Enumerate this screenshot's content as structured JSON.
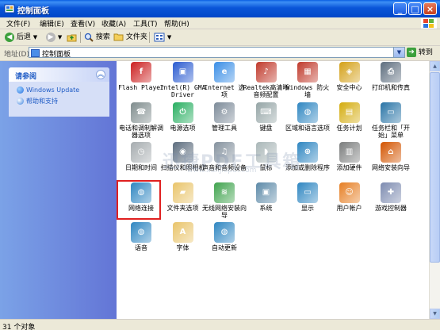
{
  "window": {
    "title": "控制面板"
  },
  "menu": [
    "文件(F)",
    "编辑(E)",
    "查看(V)",
    "收藏(A)",
    "工具(T)",
    "帮助(H)"
  ],
  "toolbar": {
    "back": "后退",
    "search": "搜索",
    "folders": "文件夹"
  },
  "address": {
    "label": "地址(D)",
    "value": "控制面板",
    "go": "转到"
  },
  "sidebar": {
    "panel_title": "请参阅",
    "links": [
      "Windows Update",
      "帮助和支持"
    ]
  },
  "items": [
    {
      "label": "Flash Player",
      "icon": "flash-icon",
      "color": "#cc1f1f"
    },
    {
      "label": "Intel(R) GMA Driver",
      "icon": "intel-display-icon",
      "color": "#2a5bd0"
    },
    {
      "label": "Internet 选项",
      "icon": "internet-options-icon",
      "color": "#3a8ee6"
    },
    {
      "label": "Realtek高清晰音频配置",
      "icon": "realtek-speaker-icon",
      "color": "#c0392b"
    },
    {
      "label": "Windows 防火墙",
      "icon": "firewall-icon",
      "color": "#c0392b"
    },
    {
      "label": "安全中心",
      "icon": "security-shield-icon",
      "color": "#d4a017"
    },
    {
      "label": "打印机和传真",
      "icon": "printer-icon",
      "color": "#5d6d7e"
    },
    {
      "label": "电话和调制解调器选项",
      "icon": "phone-modem-icon",
      "color": "#7f8c8d"
    },
    {
      "label": "电源选项",
      "icon": "power-icon",
      "color": "#27ae60"
    },
    {
      "label": "管理工具",
      "icon": "admin-tools-icon",
      "color": "#7d8b99"
    },
    {
      "label": "键盘",
      "icon": "keyboard-icon",
      "color": "#95a5a6"
    },
    {
      "label": "区域和语言选项",
      "icon": "globe-icon",
      "color": "#2e86c1"
    },
    {
      "label": "任务计划",
      "icon": "scheduled-tasks-icon",
      "color": "#d4ac0d"
    },
    {
      "label": "任务栏和「开始」菜单",
      "icon": "taskbar-icon",
      "color": "#2874a6"
    },
    {
      "label": "日期和时间",
      "icon": "clock-icon",
      "color": "#a6acaf"
    },
    {
      "label": "扫描仪和照相机",
      "icon": "scanner-camera-icon",
      "color": "#5d6d7e"
    },
    {
      "label": "声音和音频设备",
      "icon": "sound-icon",
      "color": "#85929e"
    },
    {
      "label": "鼠标",
      "icon": "mouse-icon",
      "color": "#aab7b8"
    },
    {
      "label": "添加或删除程序",
      "icon": "add-remove-programs-icon",
      "color": "#2e86c1"
    },
    {
      "label": "添加硬件",
      "icon": "add-hardware-icon",
      "color": "#7b7d7d"
    },
    {
      "label": "网络安装向导",
      "icon": "network-setup-icon",
      "color": "#d35400"
    },
    {
      "label": "网络连接",
      "icon": "network-connections-icon",
      "color": "#2e86c1"
    },
    {
      "label": "文件夹选项",
      "icon": "folder-options-icon",
      "color": "#e9c46a"
    },
    {
      "label": "无线网络安装向导",
      "icon": "wireless-icon",
      "color": "#3fa34d"
    },
    {
      "label": "系统",
      "icon": "system-icon",
      "color": "#5d8aa8"
    },
    {
      "label": "显示",
      "icon": "display-icon",
      "color": "#2e86c1"
    },
    {
      "label": "用户帐户",
      "icon": "user-accounts-icon",
      "color": "#e67e22"
    },
    {
      "label": "游戏控制器",
      "icon": "game-controller-icon",
      "color": "#7d8bb0"
    },
    {
      "label": "语音",
      "icon": "speech-icon",
      "color": "#2e86c1"
    },
    {
      "label": "字体",
      "icon": "fonts-icon",
      "color": "#e9c46a"
    },
    {
      "label": "自动更新",
      "icon": "auto-update-icon",
      "color": "#2e86c1"
    }
  ],
  "watermark": {
    "main": "迅捷PDF工具箱",
    "url": "www.xunjiepdf.com"
  },
  "status": "31 个对象"
}
